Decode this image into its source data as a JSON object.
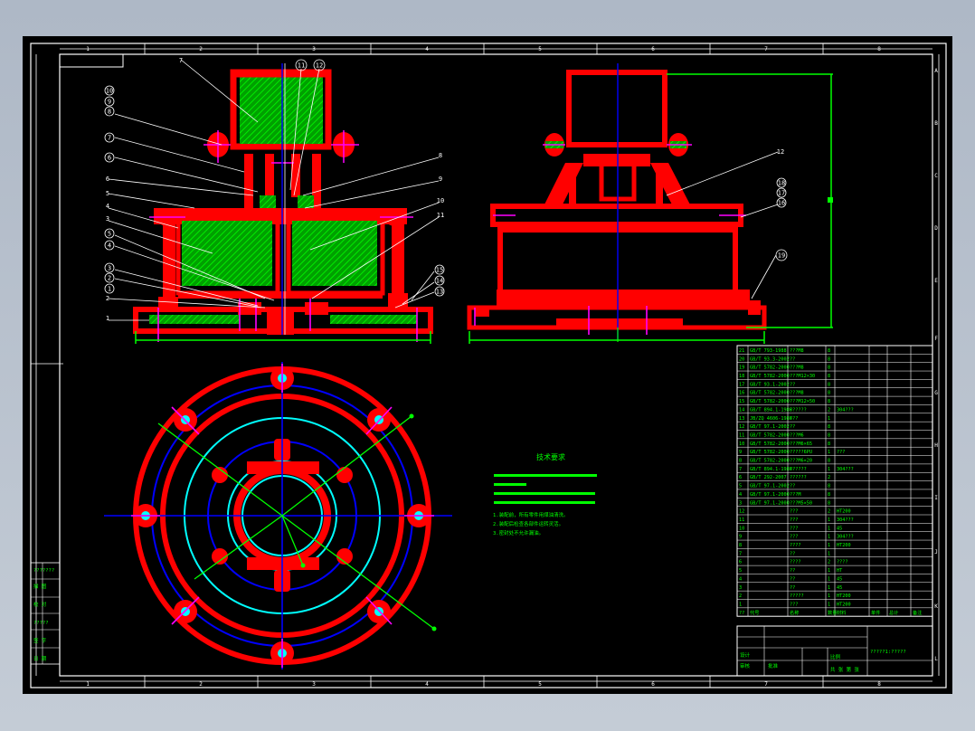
{
  "drawing": {
    "border_numbers_top": [
      "1",
      "2",
      "3",
      "4",
      "5",
      "6",
      "7",
      "8"
    ],
    "border_letters_right": [
      "A",
      "B",
      "C",
      "D",
      "E",
      "F",
      "G",
      "H",
      "I",
      "J",
      "K",
      "L"
    ],
    "balloons_left": [
      "10",
      "9",
      "8",
      "7",
      "6",
      "6",
      "5",
      "4",
      "3",
      "5",
      "4",
      "3",
      "2",
      "1",
      "2",
      "1"
    ],
    "balloons_top": [
      "11",
      "12"
    ],
    "leader_labels_right_of_section": [
      "8",
      "9",
      "10",
      "11",
      "15",
      "14",
      "13"
    ],
    "balloons_right_view": [
      "12",
      "18",
      "17",
      "16",
      "19"
    ],
    "top_left_label": "7"
  },
  "notes": {
    "title": "技术要求",
    "line1": "1.装配前，所有零件用煤油清洗。",
    "line2": "2.装配后检查各部件运转灵活。",
    "line3": "3.密封处不允许漏油。"
  },
  "bom": {
    "header": [
      "序号",
      "代号",
      "名称",
      "数量",
      "材料",
      "单件",
      "总计",
      "备注"
    ],
    "rows": [
      [
        "21",
        "GB/T 793-1988",
        "???M8",
        "8",
        "",
        ""
      ],
      [
        "20",
        "GB/T 93.3-2002",
        "??",
        "8",
        "",
        ""
      ],
      [
        "19",
        "GB/T 5782-2000",
        "???M8",
        "8",
        "",
        ""
      ],
      [
        "18",
        "GB/T 5782-2000",
        "???M12×30",
        "8",
        "",
        ""
      ],
      [
        "17",
        "GB/T 93.1-2002",
        "??",
        "8",
        "",
        ""
      ],
      [
        "16",
        "GB/T 5782-2000",
        "???M8",
        "8",
        "",
        ""
      ],
      [
        "15",
        "GB/T 5782-2000",
        "???M12×50",
        "8",
        "",
        ""
      ],
      [
        "14",
        "GB/T 894.1-1986",
        "??????",
        "2",
        "304???",
        ""
      ],
      [
        "13",
        "JB/ZQ 4606-1986",
        "???",
        "1",
        "",
        ""
      ],
      [
        "12",
        "GB/T 97.1-2002",
        "??",
        "8",
        "",
        ""
      ],
      [
        "11",
        "GB/T 5782-2000",
        "???M6",
        "8",
        "",
        ""
      ],
      [
        "10",
        "GB/T 5782-2000",
        "???M6×65",
        "8",
        "",
        ""
      ],
      [
        "9",
        "GB/T 5782-2000",
        "?????6PU",
        "1",
        "???",
        ""
      ],
      [
        "8",
        "GB/T 5782-2000",
        "???M6×20",
        "8",
        "",
        ""
      ],
      [
        "7",
        "GB/T 894.1-1986",
        "??????",
        "1",
        "304???",
        ""
      ],
      [
        "6",
        "GB/T 292-2007",
        "??????",
        "2",
        "",
        ""
      ],
      [
        "5",
        "GB/T 97.1-2002",
        "??",
        "8",
        "",
        ""
      ],
      [
        "4",
        "GB/T 97.1-2000",
        "???M",
        "8",
        "",
        ""
      ],
      [
        "3",
        "GB/T 97.1-2000",
        "???M5×50",
        "8",
        "",
        ""
      ],
      [
        "12",
        "",
        "???",
        "2",
        "HT200",
        ""
      ],
      [
        "11",
        "",
        "???",
        "1",
        "304???",
        ""
      ],
      [
        "10",
        "",
        "???",
        "1",
        "45",
        ""
      ],
      [
        "9",
        "",
        "???",
        "1",
        "304???",
        ""
      ],
      [
        "8",
        "",
        "????",
        "1",
        "HT200",
        ""
      ],
      [
        "7",
        "",
        "??",
        "1",
        "",
        ""
      ],
      [
        "6",
        "",
        "????",
        "2",
        "????",
        ""
      ],
      [
        "5",
        "",
        "??",
        "1",
        "HT",
        ""
      ],
      [
        "4",
        "",
        "??",
        "1",
        "45",
        ""
      ],
      [
        "3",
        "",
        "??",
        "1",
        "45",
        ""
      ],
      [
        "2",
        "",
        "?????",
        "1",
        "HT200",
        ""
      ],
      [
        "1",
        "",
        "???",
        "1",
        "HT200",
        ""
      ]
    ],
    "footer_cols": [
      "??",
      "代号",
      "名称",
      "数量",
      "材料",
      "单件",
      "总计",
      "备注"
    ]
  },
  "title_block": {
    "drawing_name": "?????1:?????",
    "scale_label": "比例",
    "sheet_label": "共 张 第 张",
    "design": "设计",
    "check": "审核",
    "approve": "批准"
  },
  "side_panel": {
    "labels": [
      "???????",
      "描 图",
      "校 对",
      "?????",
      "签 字",
      "日 期"
    ]
  }
}
